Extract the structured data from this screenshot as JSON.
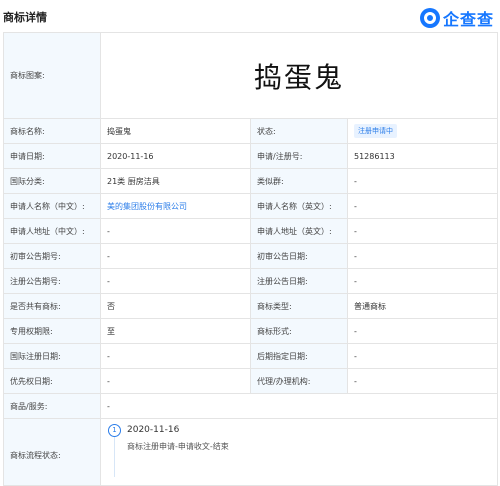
{
  "header": {
    "title": "商标详情",
    "logo_text": "企查查"
  },
  "mark_image": {
    "label": "商标图案:",
    "text": "捣蛋鬼"
  },
  "rows": [
    {
      "l1": "商标名称:",
      "v1": "捣蛋鬼",
      "l2": "状态:",
      "v2": "注册申请中"
    },
    {
      "l1": "申请日期:",
      "v1": "2020-11-16",
      "l2": "申请/注册号:",
      "v2": "51286113"
    },
    {
      "l1": "国际分类:",
      "v1": "21类 厨房洁具",
      "l2": "类似群:",
      "v2": "-"
    },
    {
      "l1": "申请人名称（中文）:",
      "v1": "美的集团股份有限公司",
      "l2": "申请人名称（英文）:",
      "v2": "-"
    },
    {
      "l1": "申请人地址（中文）:",
      "v1": "-",
      "l2": "申请人地址（英文）:",
      "v2": "-"
    },
    {
      "l1": "初审公告期号:",
      "v1": "-",
      "l2": "初审公告日期:",
      "v2": "-"
    },
    {
      "l1": "注册公告期号:",
      "v1": "-",
      "l2": "注册公告日期:",
      "v2": "-"
    },
    {
      "l1": "是否共有商标:",
      "v1": "否",
      "l2": "商标类型:",
      "v2": "普通商标"
    },
    {
      "l1": "专用权期限:",
      "v1": "至",
      "l2": "商标形式:",
      "v2": "-"
    },
    {
      "l1": "国际注册日期:",
      "v1": "-",
      "l2": "后期指定日期:",
      "v2": "-"
    },
    {
      "l1": "优先权日期:",
      "v1": "-",
      "l2": "代理/办理机构:",
      "v2": "-"
    }
  ],
  "services": {
    "label": "商品/服务:",
    "value": "-"
  },
  "flow": {
    "label": "商标流程状态:",
    "steps": [
      {
        "num": "1",
        "date": "2020-11-16",
        "desc": "商标注册申请-申请收文-结束"
      }
    ]
  },
  "colors": {
    "accent": "#2b7de9",
    "label_bg": "#f3f9fe"
  }
}
